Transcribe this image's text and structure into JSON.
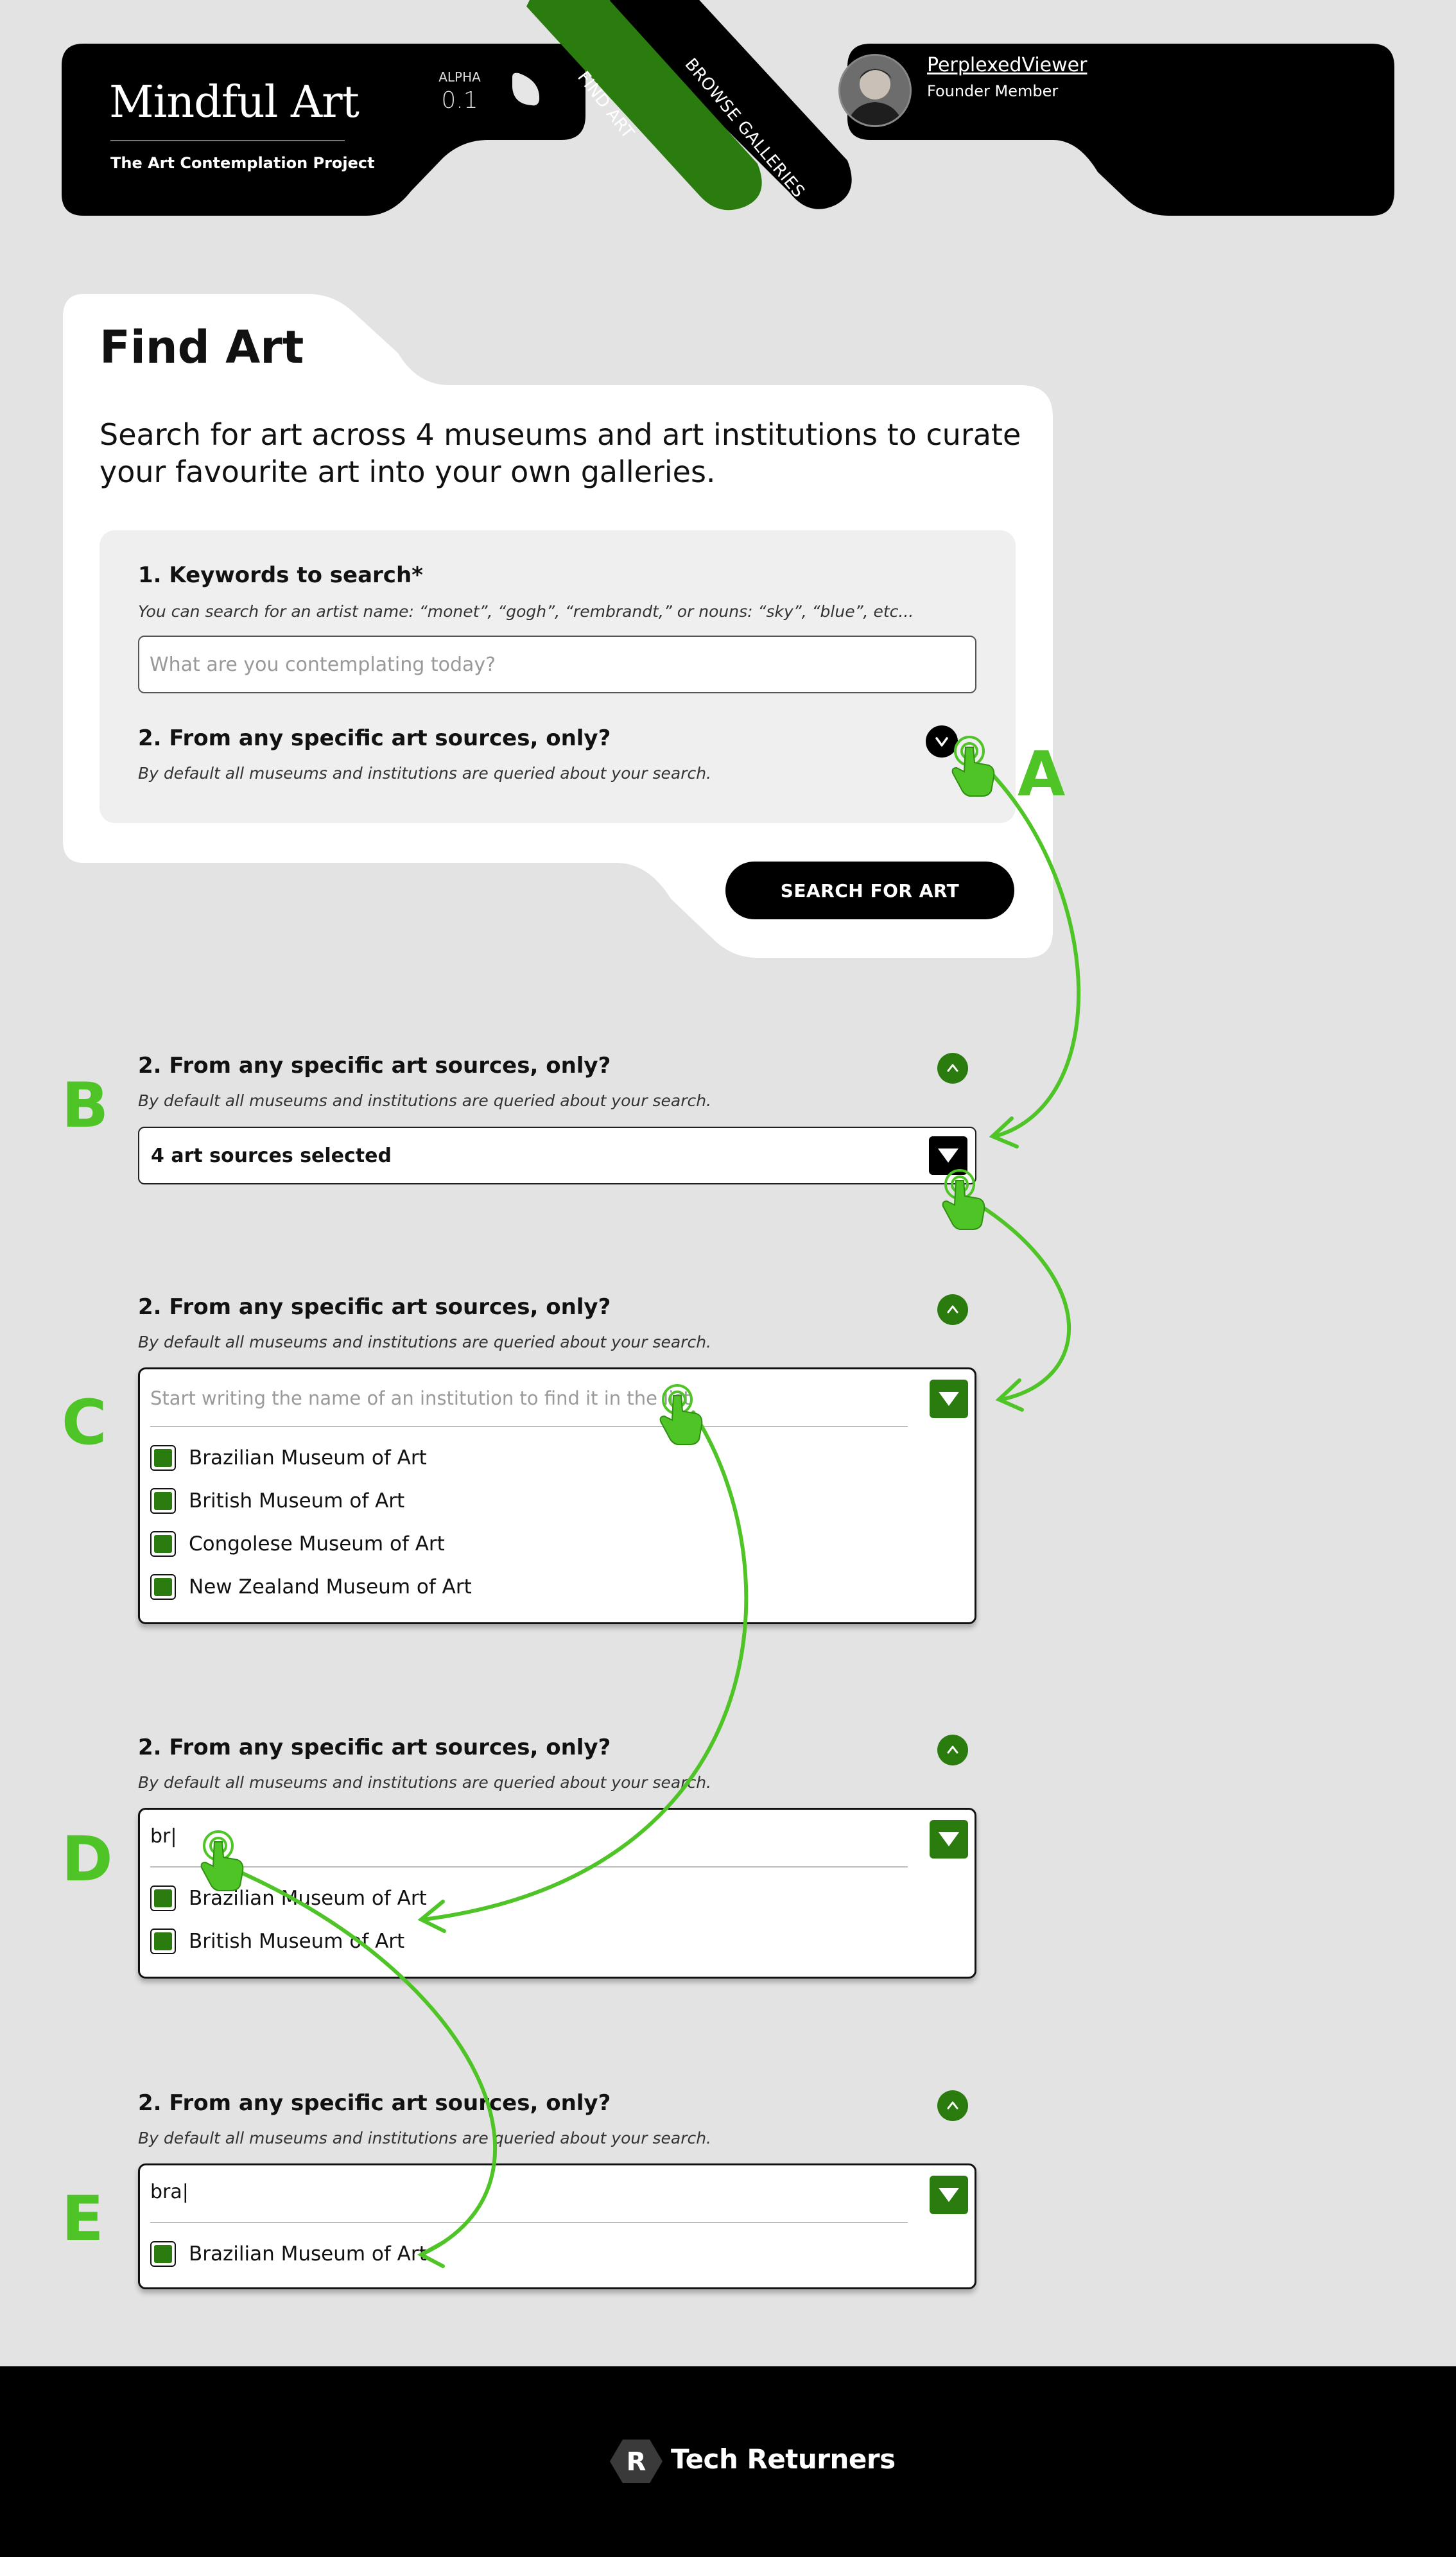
{
  "header": {
    "brand_title": "Mindful Art",
    "brand_subtitle": "The Art Contemplation Project",
    "version_label": "ALPHA",
    "version_number": "0.1",
    "tabs": [
      {
        "label": "FIND ART",
        "active": true,
        "color": "#2a7c0e"
      },
      {
        "label": "BROWSE GALLERIES",
        "active": false,
        "color": "#000000"
      }
    ],
    "user": {
      "name": "PerplexedViewer",
      "title": "Founder Member",
      "avatar_icon": "user-avatar"
    }
  },
  "find_card": {
    "title": "Find Art",
    "intro": "Search for art across 4 museums and art institutions to curate your favourite art into your own galleries.",
    "question1": {
      "title": "1. Keywords to search*",
      "hint": "You can search for an artist name: “monet”, “gogh”, “rembrandt,” or nouns: “sky”, “blue”, etc...",
      "placeholder": "What are you contemplating today?"
    },
    "question2": {
      "title": "2. From any specific art sources, only?",
      "hint": "By default all museums and institutions are queried about your search.",
      "toggle_icon": "chevron-down-icon"
    },
    "search_button": "SEARCH FOR ART"
  },
  "steps": {
    "B": {
      "letter": "B",
      "title": "2. From any specific art sources, only?",
      "hint": "By default all museums and institutions are queried about your search.",
      "select_value": "4 art sources selected"
    },
    "C": {
      "letter": "C",
      "title": "2. From any specific art sources, only?",
      "hint": "By default all museums and institutions are queried about your search.",
      "filter_placeholder": "Start writing the name of an institution to find it in the list",
      "options": [
        "Brazilian Museum of Art",
        "British Museum of Art",
        "Congolese Museum of Art",
        "New Zealand Museum of Art"
      ]
    },
    "D": {
      "letter": "D",
      "title": "2. From any specific art sources, only?",
      "hint": "By default all museums and institutions are queried about your search.",
      "filter_value": "br|",
      "options": [
        "Brazilian Museum of Art",
        "British Museum of Art"
      ]
    },
    "E": {
      "letter": "E",
      "title": "2. From any specific art sources, only?",
      "hint": "By default all museums and institutions are queried about your search.",
      "filter_value": "bra|",
      "options": [
        "Brazilian Museum of Art"
      ]
    }
  },
  "annotation_letter_A": "A",
  "footer": {
    "logo_text": "Tech Returners"
  },
  "colors": {
    "background": "#e3e3e3",
    "accent_green": "#2a7c0e",
    "annotation_green": "#4fc427",
    "black": "#000000"
  }
}
